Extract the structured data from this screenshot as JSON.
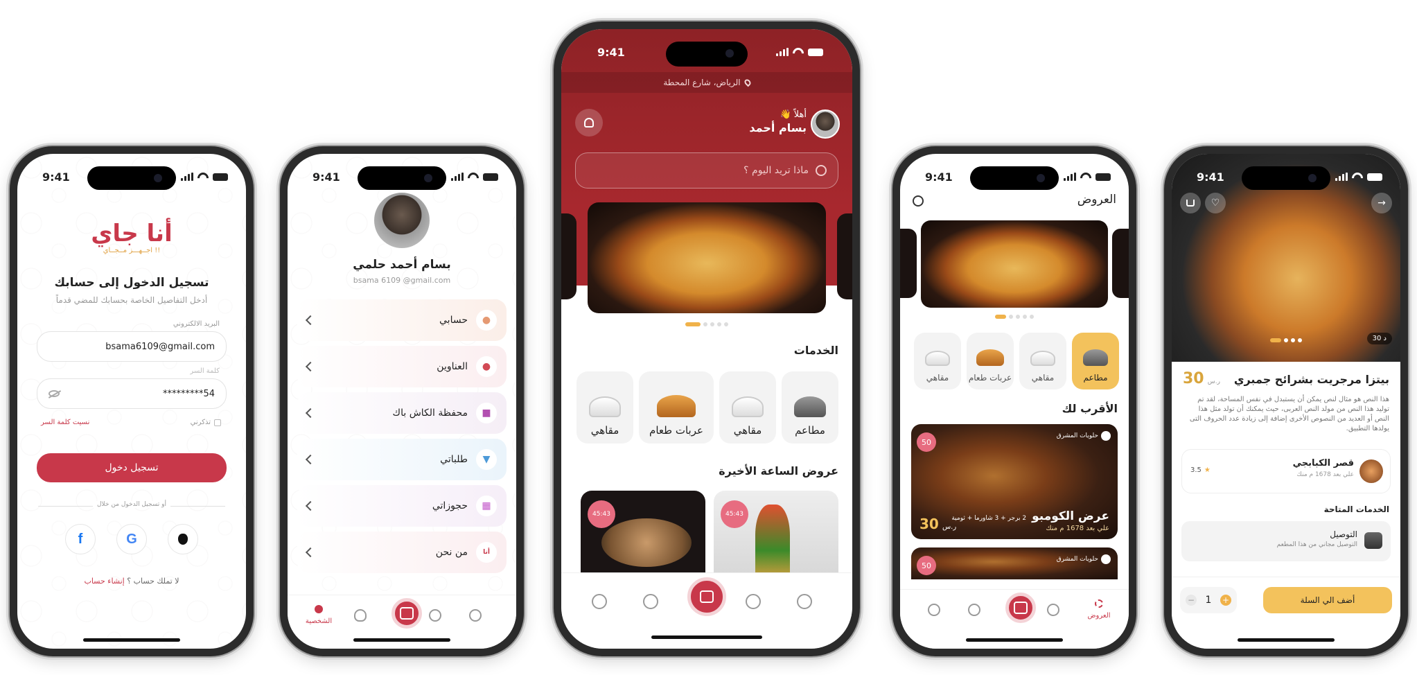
{
  "status_time": "9:41",
  "phone1": {
    "logo_text": "أنا جاي",
    "logo_tagline": "اجــهـــز مــجــاي !!",
    "title": "تسجيل الدخول إلى حسابك",
    "subtitle": "أدخل التفاصيل الخاصة بحسابك للمضي قدماً",
    "email_label": "البريد الالكتروني",
    "email_value": "bsama6109@gmail.com",
    "password_label": "كلمة السر",
    "password_value": "54*********",
    "remember_label": "تذكرني",
    "forgot_label": "نسيت كلمة السر",
    "login_button": "تسجيل دخول",
    "or_label": "أو تسجيل الدخول من خلال",
    "no_account": "لا تملك حساب ؟",
    "create_account": "إنشاء حساب"
  },
  "phone2": {
    "user_name": "بسام أحمد حلمي",
    "user_email": "bsama 6109 @gmail.com",
    "menu": [
      {
        "label": "حسابي",
        "icon": "user-icon",
        "bg": "#fbeee8",
        "color": "#e59a73"
      },
      {
        "label": "العناوين",
        "icon": "location-pin-icon",
        "bg": "#fbeef0",
        "color": "#d24a55"
      },
      {
        "label": "محفظة الكاش باك",
        "icon": "gift-icon",
        "bg": "#f5eef6",
        "color": "#b24fb0"
      },
      {
        "label": "طلباتي",
        "icon": "basket-icon",
        "bg": "#eaf4fb",
        "color": "#4d9ad8"
      },
      {
        "label": "حجوزاتي",
        "icon": "calendar-icon",
        "bg": "#f6eef8",
        "color": "#c153c8"
      },
      {
        "label": "من نحن",
        "icon": "brand-logo-icon",
        "bg": "#fbeef0",
        "color": "#c8384a"
      }
    ],
    "nav_profile": "الشخصية"
  },
  "phone3": {
    "location": "الرياض، شارع المحطة",
    "greeting": "أهلاً 👋",
    "user_name": "بسام أحمد",
    "search_placeholder": "ماذا تريد اليوم ؟",
    "services_title": "الخدمات",
    "services": [
      "مطاعم",
      "مقاهي",
      "عربات طعام",
      "مقاهي"
    ],
    "offers_title": "عروض الساعة الأخيرة",
    "badge_time_1": "45:43",
    "badge_time_2": "45:43"
  },
  "phone4": {
    "header_title": "العروض",
    "categories": [
      "مطاعم",
      "مقاهي",
      "عربات طعام",
      "مقاهي"
    ],
    "nearest_title": "الأقرب لك",
    "card_vendor": "حلويات المشرق",
    "card_badge": "50",
    "card_title": "عرض الكومبو",
    "card_desc": "2 برجر + 3 شاورما + ثومية",
    "card_distance": "علي بعد 1678 م منك",
    "card_price": "30",
    "card_currency": "ر.س",
    "card2_vendor": "حلويات المشرق",
    "card2_badge": "50",
    "nav_offers": "العروض"
  },
  "phone5": {
    "delivery_time": "30 د",
    "product_title": "بيتزا مرجريت بشرائح جمبري",
    "price": "30",
    "currency": "ر.س",
    "description": "هذا النص هو مثال لنص يمكن أن يستبدل في نفس المساحة، لقد تم توليد هذا النص من مولد النص العربى، حيث يمكنك أن تولد مثل هذا النص أو العديد من النصوص الأخرى إضافة إلى زيادة عدد الحروف التى يولدها التطبيق.",
    "restaurant_name": "قصر الكبابجي",
    "restaurant_distance": "علي بعد 1678 م منك",
    "rating": "3.5",
    "services_title": "الخدمات المتاحة",
    "delivery_label": "التوصيل",
    "delivery_desc": "التوصيل مجاني من هذا المطعم",
    "quantity": "1",
    "add_to_cart": "أضف الي السلة"
  }
}
